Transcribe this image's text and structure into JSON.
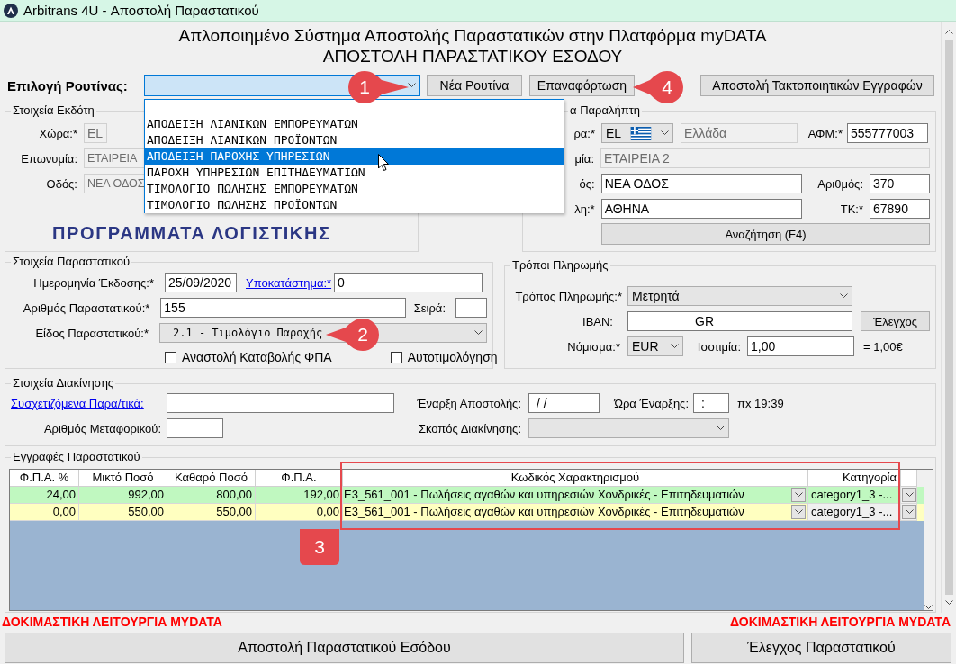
{
  "window": {
    "title": "Arbitrans 4U - Αποστολή Παραστατικού"
  },
  "header": {
    "title": "Απλοποιημένο Σύστημα Αποστολής Παραστατικών στην Πλατφόρμα myDATA",
    "subtitle": "ΑΠΟΣΤΟΛΗ ΠΑΡΑΣΤΑΤΙΚΟΥ ΕΣΟΔΟΥ"
  },
  "routine": {
    "label": "Επιλογή Ρουτίνας:",
    "expanded": true,
    "options": [
      {
        "label": "ΑΠΟΔΕΙΞΗ ΛΙΑΝΙΚΩΝ ΕΜΠΟΡΕΥΜΑΤΩΝ",
        "selected": false
      },
      {
        "label": "ΑΠΟΔΕΙΞΗ ΛΙΑΝΙΚΩΝ ΠΡΟΪΟΝΤΩΝ",
        "selected": false
      },
      {
        "label": "ΑΠΟΔΕΙΞΗ ΠΑΡΟΧΗΣ ΥΠΗΡΕΣΙΩΝ",
        "selected": true
      },
      {
        "label": "ΠΑΡΟΧΗ ΥΠΗΡΕΣΙΩΝ ΕΠΙΤΗΔΕΥΜΑΤΙΩΝ",
        "selected": false
      },
      {
        "label": "ΤΙΜΟΛΟΓΙΟ ΠΩΛΗΣΗΣ ΕΜΠΟΡΕΥΜΑΤΩΝ",
        "selected": false
      },
      {
        "label": "ΤΙΜΟΛΟΓΙΟ ΠΩΛΗΣΗΣ ΠΡΟΪΟΝΤΩΝ",
        "selected": false
      }
    ]
  },
  "toolbar_buttons": [
    "Νέα Ρουτίνα",
    "Επαναφόρτωση",
    "Αποστολή Τακτοποιητικών Εγγραφών"
  ],
  "issuer": {
    "title": "Στοιχεία Εκδότη",
    "fields": [
      {
        "label": "Χώρα:*",
        "value": "EL",
        "disabled": true
      },
      {
        "label": "Επωνυμία:",
        "value": "ΕΤΑΙΡΕΙΑ",
        "disabled": true
      },
      {
        "label": "Οδός:",
        "value": "ΝΕΑ ΟΔΟΣ",
        "disabled": true
      }
    ],
    "logo_tagline": "ΠΡΟΓΡΑΜΜΑΤΑ ΛΟΓΙΣΤΙΚΗΣ"
  },
  "receiver": {
    "title": "α Παραλήπτη",
    "country": {
      "label": "ρα:*",
      "code": "EL"
    },
    "country_name": {
      "value": "Ελλάδα",
      "disabled": true
    },
    "vat": {
      "label": "ΑΦΜ:*",
      "value": "555777003",
      "disabled": false
    },
    "name": {
      "label": "μία:",
      "value": "ΕΤΑΙΡΕΙΑ 2",
      "disabled": true
    },
    "street": {
      "label": "ός:",
      "value": "ΝΕΑ ΟΔΟΣ",
      "disabled": false
    },
    "number": {
      "label": "Αριθμός:",
      "value": "370",
      "disabled": false
    },
    "city": {
      "label": "λη:*",
      "value": "ΑΘΗΝΑ",
      "disabled": false
    },
    "zip": {
      "label": "ΤΚ:*",
      "value": "67890",
      "disabled": false
    },
    "search_button": "Αναζήτηση (F4)"
  },
  "document": {
    "title": "Στοιχεία Παραστατικού",
    "date": {
      "label": "Ημερομηνία Έκδοσης:*",
      "value": "25/09/2020",
      "disabled": false
    },
    "branch": {
      "link": "Υποκατάστημα:*",
      "value": "0",
      "disabled": false
    },
    "number": {
      "label": "Αριθμός Παραστατικού:*",
      "value": "155",
      "disabled": false
    },
    "series": {
      "label": "Σειρά:",
      "disabled": false
    },
    "type": {
      "label": "Είδος Παραστατικού:*",
      "value": "2.1 - Τιμολόγιο Παροχής"
    },
    "checkboxes": [
      {
        "label": "Αναστολή Καταβολής ΦΠΑ",
        "checked": false
      },
      {
        "label": "Αυτοτιμολόγηση",
        "checked": false
      }
    ]
  },
  "payment": {
    "title": "Τρόποι Πληρωμής",
    "method": {
      "label": "Τρόπος Πληρωμής:*",
      "value": "Μετρητά"
    },
    "iban": {
      "label": "IBAN:",
      "value": "GR",
      "disabled": false
    },
    "check_button": "Έλεγχος",
    "currency": {
      "label": "Νόμισμα:*",
      "value": "EUR"
    },
    "rate": {
      "label": "Ισοτιμία:",
      "value": "1,00",
      "disabled": false
    },
    "equivalent": "= 1,00€"
  },
  "transport": {
    "title": "Στοιχεία Διακίνησης",
    "related": {
      "link": "Συσχετιζόμενα Παρα/τικά:",
      "disabled": false
    },
    "start_date": {
      "label": "Έναρξη Αποστολής:",
      "value": "/ /",
      "disabled": false
    },
    "start_time": {
      "label": "Ώρα Έναρξης:",
      "value": ":",
      "disabled": false
    },
    "time_hint": "πx 19:39",
    "carrier": {
      "label": "Αριθμός Μεταφορικού:",
      "disabled": false
    },
    "purpose": {
      "label": "Σκοπός Διακίνησης:"
    }
  },
  "entries": {
    "title": "Εγγραφές Παραστατικού",
    "columns": [
      "Φ.Π.Α. %",
      "Μικτό Ποσό",
      "Καθαρό Ποσό",
      "Φ.Π.Α.",
      "Κωδικός Χαρακτηρισμού",
      "Κατηγορία"
    ],
    "rows": [
      {
        "color": "#c0f8c0",
        "cells": [
          "24,00",
          "992,00",
          "800,00",
          "192,00",
          "E3_561_001 - Πωλήσεις αγαθών και υπηρεσιών Χονδρικές - Επιτηδευματιών",
          "category1_3  -..."
        ]
      },
      {
        "color": "#ffffc0",
        "cells": [
          "0,00",
          "550,00",
          "550,00",
          "0,00",
          "E3_561_001 - Πωλήσεις αγαθών και υπηρεσιών Χονδρικές - Επιτηδευματιών",
          "category1_3  -..."
        ]
      }
    ]
  },
  "test_mode_labels": [
    "ΔΟΚΙΜΑΣΤΙΚΗ ΛΕΙΤΟΥΡΓΙΑ MYDATA",
    "ΔΟΚΙΜΑΣΤΙΚΗ ΛΕΙΤΟΥΡΓΙΑ MYDATA"
  ],
  "footer_buttons": [
    "Αποστολή Παραστατικού Εσόδου",
    "Έλεγχος Παραστατικού"
  ],
  "callouts": [
    "1",
    "2",
    "3",
    "4"
  ]
}
